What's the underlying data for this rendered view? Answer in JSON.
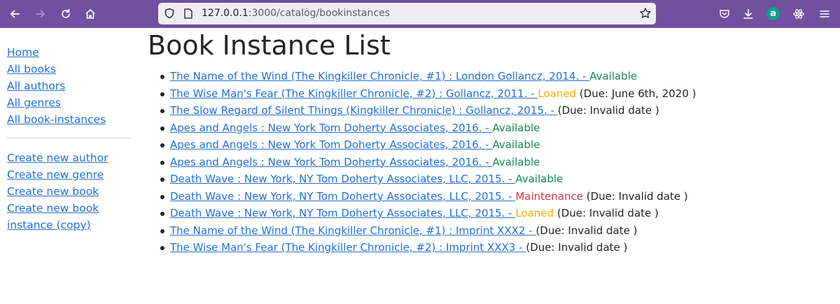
{
  "browser": {
    "url_host": "127.0.0.1",
    "url_path": ":3000/catalog/bookinstances"
  },
  "sidebar": {
    "links": [
      "Home",
      "All books",
      "All authors",
      "All genres",
      "All book-instances"
    ],
    "create_links": [
      "Create new author",
      "Create new genre",
      "Create new book",
      "Create new book",
      "instance (copy)"
    ]
  },
  "page_title": "Book Instance List",
  "instances": [
    {
      "link": "The Name of the Wind (The Kingkiller Chronicle, #1) : London Gollancz, 2014. - ",
      "status": "Available",
      "due": ""
    },
    {
      "link": "The Wise Man's Fear (The Kingkiller Chronicle, #2) : Gollancz, 2011. - ",
      "status": "Loaned",
      "due": " (Due: June 6th, 2020 )"
    },
    {
      "link": "The Slow Regard of Silent Things (Kingkiller Chronicle) : Gollancz, 2015. - ",
      "status": "",
      "due": "(Due: Invalid date )"
    },
    {
      "link": "Apes and Angels : New York Tom Doherty Associates, 2016. - ",
      "status": "Available",
      "due": ""
    },
    {
      "link": "Apes and Angels : New York Tom Doherty Associates, 2016. - ",
      "status": "Available",
      "due": ""
    },
    {
      "link": "Apes and Angels : New York Tom Doherty Associates, 2016. - ",
      "status": "Available",
      "due": ""
    },
    {
      "link": "Death Wave : New York, NY Tom Doherty Associates, LLC, 2015. - ",
      "status": "Available",
      "due": ""
    },
    {
      "link": "Death Wave : New York, NY Tom Doherty Associates, LLC, 2015. - ",
      "status": "Maintenance",
      "due": " (Due: Invalid date )"
    },
    {
      "link": "Death Wave : New York, NY Tom Doherty Associates, LLC, 2015. - ",
      "status": "Loaned",
      "due": " (Due: Invalid date )"
    },
    {
      "link": "The Name of the Wind (The Kingkiller Chronicle, #1) : Imprint XXX2 - ",
      "status": "",
      "due": "(Due: Invalid date )"
    },
    {
      "link": "The Wise Man's Fear (The Kingkiller Chronicle, #2) : Imprint XXX3 - ",
      "status": "",
      "due": "(Due: Invalid date )"
    }
  ],
  "colors": {
    "toolbar": "#7250a0",
    "link": "#2470d4",
    "available": "#198754",
    "loaned": "#f0ad08",
    "maintenance": "#dc3545"
  }
}
